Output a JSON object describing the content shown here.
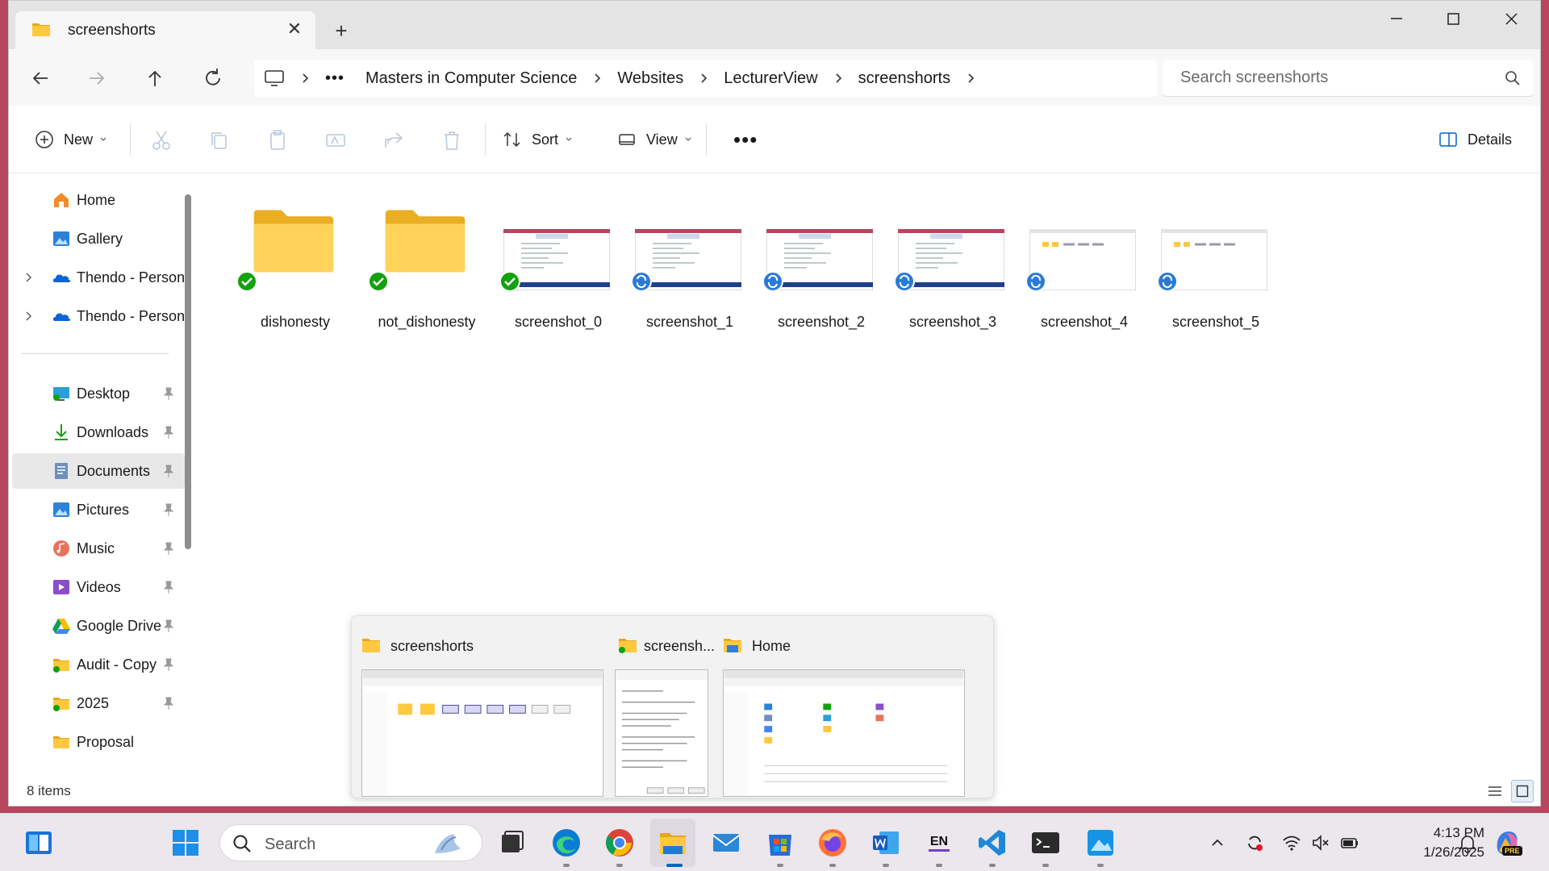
{
  "window": {
    "tab_title": "screenshorts",
    "breadcrumbs": [
      "Masters in Computer Science",
      "Websites",
      "LecturerView",
      "screenshorts"
    ],
    "search_placeholder": "Search screenshorts"
  },
  "commandbar": {
    "new_label": "New",
    "sort_label": "Sort",
    "view_label": "View",
    "details_label": "Details"
  },
  "nav": {
    "items": [
      {
        "label": "Home",
        "icon": "home-icon"
      },
      {
        "label": "Gallery",
        "icon": "gallery-icon"
      },
      {
        "label": "Thendo - Person",
        "icon": "onedrive-icon"
      },
      {
        "label": "Thendo - Person",
        "icon": "onedrive-icon"
      },
      {
        "label": "Desktop",
        "icon": "desktop-icon"
      },
      {
        "label": "Downloads",
        "icon": "downloads-icon"
      },
      {
        "label": "Documents",
        "icon": "documents-icon"
      },
      {
        "label": "Pictures",
        "icon": "pictures-icon"
      },
      {
        "label": "Music",
        "icon": "music-icon"
      },
      {
        "label": "Videos",
        "icon": "videos-icon"
      },
      {
        "label": "Google Drive",
        "icon": "google-drive-icon"
      },
      {
        "label": "Audit - Copy",
        "icon": "folder-icon"
      },
      {
        "label": "2025",
        "icon": "folder-icon"
      },
      {
        "label": "Proposal",
        "icon": "folder-icon"
      }
    ]
  },
  "files": [
    {
      "name": "dishonesty",
      "type": "folder",
      "status": "synced"
    },
    {
      "name": "not_dishonesty",
      "type": "folder",
      "status": "synced"
    },
    {
      "name": "screenshot_0",
      "type": "image",
      "status": "synced"
    },
    {
      "name": "screenshot_1",
      "type": "image",
      "status": "syncing"
    },
    {
      "name": "screenshot_2",
      "type": "image",
      "status": "syncing"
    },
    {
      "name": "screenshot_3",
      "type": "image",
      "status": "syncing"
    },
    {
      "name": "screenshot_4",
      "type": "image",
      "status": "syncing"
    },
    {
      "name": "screenshot_5",
      "type": "image",
      "status": "syncing"
    }
  ],
  "status": {
    "item_count": "8 items"
  },
  "preview": {
    "windows": [
      {
        "title": "screenshorts"
      },
      {
        "title": "screensh..."
      },
      {
        "title": "Home"
      }
    ]
  },
  "taskbar": {
    "search_label": "Search",
    "time": "4:13 PM",
    "date": "1/26/2025",
    "language": "EN",
    "copilot_badge": "PRE"
  },
  "colors": {
    "accent": "#0067c0",
    "folder": "#ffc83d",
    "synced": "#13a10e",
    "syncing": "#2b7bd6",
    "desktop_bg": "#b8465f"
  }
}
